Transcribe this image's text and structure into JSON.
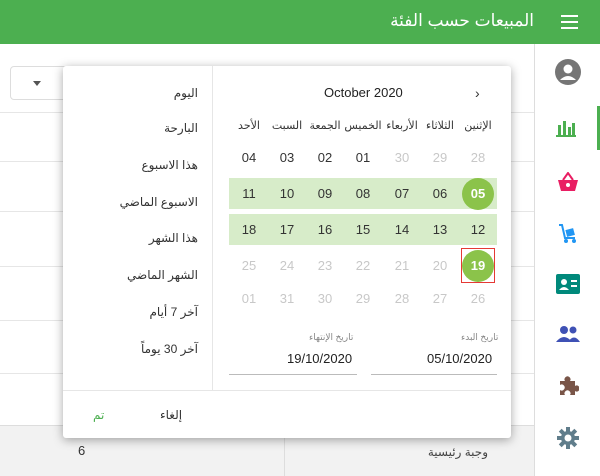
{
  "app": {
    "title": "المبيعات حسب الفئة"
  },
  "background_row": {
    "value": "6",
    "label": "وجبة رئيسية"
  },
  "calendar": {
    "month_title": "October 2020",
    "weekdays": [
      "الإثنين",
      "الثلاثاء",
      "الأربعاء",
      "الخميس",
      "الجمعة",
      "السبت",
      "الأحد"
    ],
    "weeks": [
      [
        "28",
        "29",
        "30",
        "01",
        "02",
        "03",
        "04"
      ],
      [
        "05",
        "06",
        "07",
        "08",
        "09",
        "10",
        "11"
      ],
      [
        "12",
        "13",
        "14",
        "15",
        "16",
        "17",
        "18"
      ],
      [
        "19",
        "20",
        "21",
        "22",
        "23",
        "24",
        "25"
      ],
      [
        "26",
        "27",
        "28",
        "29",
        "30",
        "31",
        "01"
      ]
    ],
    "start_date_label": "تاريخ البدء",
    "start_date": "05/10/2020",
    "end_date_label": "تاريخ الإنتهاء",
    "end_date": "19/10/2020"
  },
  "presets": [
    "اليوم",
    "البارحة",
    "هذا الاسبوع",
    "الاسبوع الماضي",
    "هذا الشهر",
    "الشهر الماضي",
    "آخر 7 أيام",
    "آخر 30 يوماً"
  ],
  "footer": {
    "ok": "تم",
    "cancel": "إلغاء"
  },
  "colors": {
    "accent": "#4caf50",
    "range": "#d7ecc9",
    "selected": "#8bc34a"
  },
  "rail_icons": [
    "account-icon",
    "chart-icon",
    "basket-icon",
    "cart-icon",
    "contact-card-icon",
    "people-icon",
    "puzzle-icon",
    "gear-icon"
  ]
}
